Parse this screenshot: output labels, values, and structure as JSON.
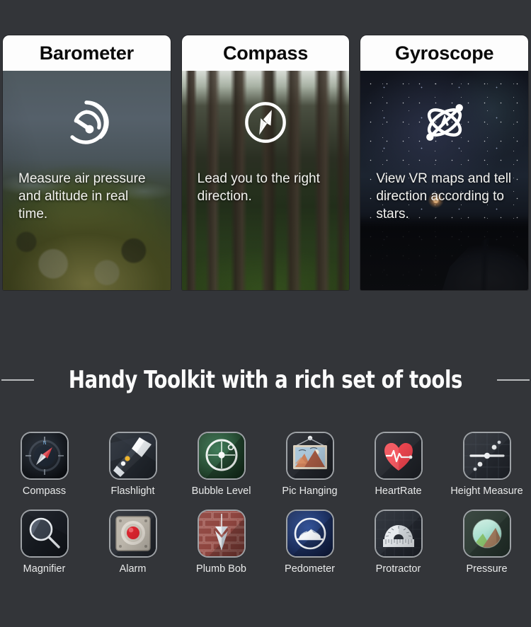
{
  "background_color": "#333539",
  "feature_cards": [
    {
      "title": "Barometer",
      "description": "Measure air pressure and altitude in real time.",
      "icon": "gauge-icon",
      "photo": "mountain-ridge-photo"
    },
    {
      "title": "Compass",
      "description": "Lead you to the right direction.",
      "icon": "compass-needle-icon",
      "photo": "forest-photo"
    },
    {
      "title": "Gyroscope",
      "description": "View VR maps and tell direction according to stars.",
      "icon": "atom-orbit-icon",
      "photo": "starry-night-tent-photo"
    }
  ],
  "section": {
    "heading": "Handy Toolkit with a rich set of tools",
    "rule_color": "#b9bbbd"
  },
  "tools": [
    {
      "label": "Compass",
      "icon": "compass-app-icon",
      "accent": "#d6373f"
    },
    {
      "label": "Flashlight",
      "icon": "flashlight-app-icon",
      "accent": "#f0b429"
    },
    {
      "label": "Bubble Level",
      "icon": "bubble-level-app-icon",
      "accent": "#2f6b46"
    },
    {
      "label": "Pic Hanging",
      "icon": "picture-hanging-app-icon",
      "accent": "#c87b55"
    },
    {
      "label": "HeartRate",
      "icon": "heart-rate-app-icon",
      "accent": "#e8404a"
    },
    {
      "label": "Height Measure",
      "icon": "height-measure-app-icon",
      "accent": "#e8eaec"
    },
    {
      "label": "Magnifier",
      "icon": "magnifier-app-icon",
      "accent": "#dfe4ea"
    },
    {
      "label": "Alarm",
      "icon": "alarm-bell-app-icon",
      "accent": "#d6202a"
    },
    {
      "label": "Plumb Bob",
      "icon": "plumb-bob-app-icon",
      "accent": "#9b4a44"
    },
    {
      "label": "Pedometer",
      "icon": "pedometer-app-icon",
      "accent": "#1f3a7a"
    },
    {
      "label": "Protractor",
      "icon": "protractor-app-icon",
      "accent": "#cfd4d8"
    },
    {
      "label": "Pressure",
      "icon": "pressure-app-icon",
      "accent": "#8fd6a8"
    }
  ]
}
